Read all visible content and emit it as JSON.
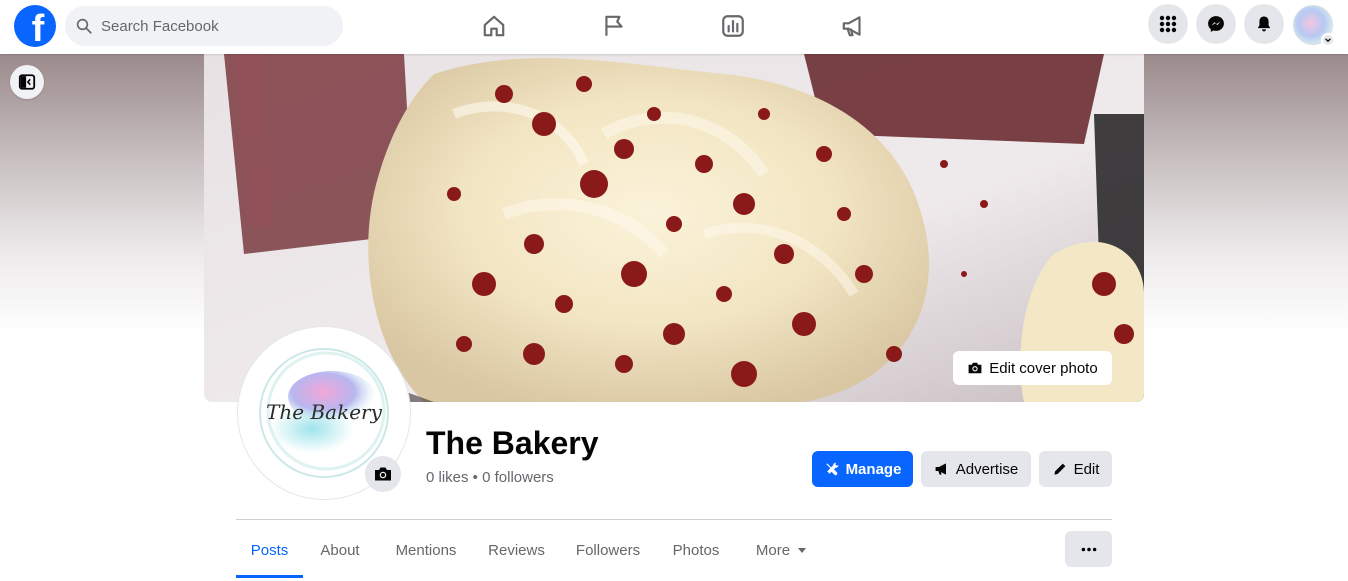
{
  "app": {
    "brand_color": "#0866ff",
    "logo_letter": "f"
  },
  "search": {
    "placeholder": "Search Facebook"
  },
  "nav": {
    "icons": [
      "home-icon",
      "flag-icon",
      "insights-icon",
      "megaphone-icon"
    ]
  },
  "header_right": {
    "icons": [
      "menu-grid-icon",
      "messenger-icon",
      "bell-icon",
      "account-avatar"
    ]
  },
  "cover": {
    "edit_label": "Edit cover photo"
  },
  "profile": {
    "logo_text": "The Bakery",
    "name": "The Bakery",
    "stats": "0 likes • 0 followers"
  },
  "actions": {
    "manage": "Manage",
    "advertise": "Advertise",
    "edit": "Edit"
  },
  "tabs": [
    {
      "label": "Posts",
      "active": true
    },
    {
      "label": "About"
    },
    {
      "label": "Mentions"
    },
    {
      "label": "Reviews"
    },
    {
      "label": "Followers"
    },
    {
      "label": "Photos"
    },
    {
      "label": "More"
    }
  ]
}
